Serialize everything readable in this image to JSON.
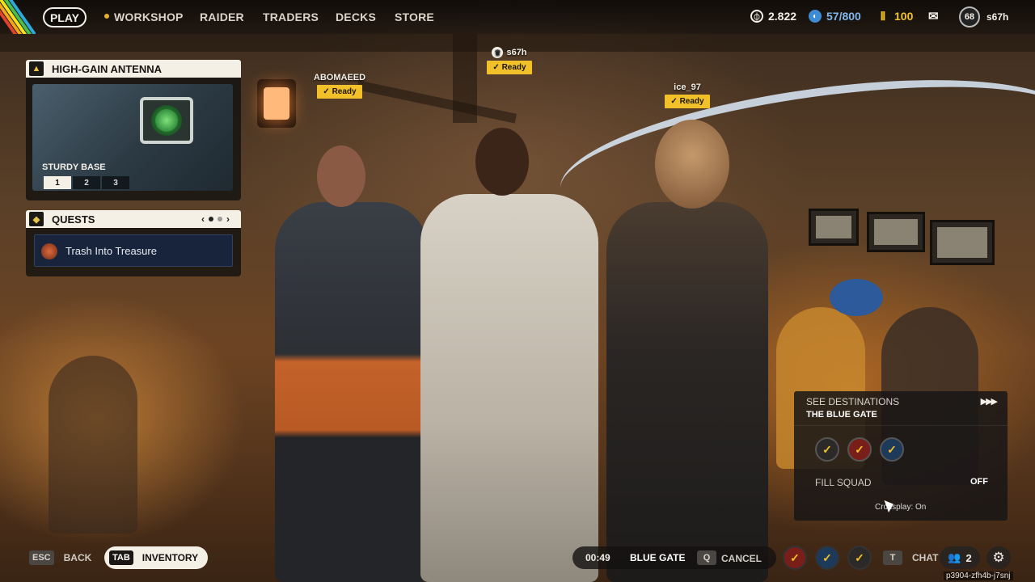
{
  "nav": {
    "play": "PLAY",
    "items": [
      "WORKSHOP",
      "RAIDER",
      "TRADERS",
      "DECKS",
      "STORE"
    ],
    "currencies": [
      {
        "icon": "coin-icon",
        "value": "2.822"
      },
      {
        "icon": "raider-token-icon",
        "value": "57/800"
      },
      {
        "icon": "credits-icon",
        "value": "100"
      }
    ],
    "level": "68",
    "username": "s67h"
  },
  "antenna": {
    "title": "HIGH-GAIN ANTENNA",
    "subtitle": "STURDY BASE",
    "tiers": [
      "1",
      "2",
      "3"
    ],
    "selected_tier": "1"
  },
  "quests": {
    "title": "QUESTS",
    "items": [
      "Trash Into Treasure"
    ]
  },
  "players": [
    {
      "name": "ABOMAEED",
      "status": "Ready",
      "leader": false
    },
    {
      "name": "s67h",
      "status": "Ready",
      "leader": true
    },
    {
      "name": "ice_97",
      "status": "Ready",
      "leader": false
    }
  ],
  "destination": {
    "header": "SEE DESTINATIONS",
    "name": "THE BLUE GATE",
    "fill_squad_label": "FILL SQUAD",
    "fill_squad_value": "OFF",
    "crossplay": "Crossplay: On"
  },
  "bottom": {
    "esc_key": "ESC",
    "back": "BACK",
    "tab_key": "TAB",
    "inventory": "INVENTORY",
    "timer": "00:49",
    "location": "BLUE GATE",
    "q_key": "Q",
    "cancel": "CANCEL",
    "t_key": "T",
    "chat": "CHAT",
    "friends_count": "2",
    "session_id": "p3904-zfh4b-j7snj"
  },
  "colors": {
    "accent_yellow": "#f2c12a",
    "panel_light": "#f4f0e6",
    "quest_bg": "#17243c"
  }
}
